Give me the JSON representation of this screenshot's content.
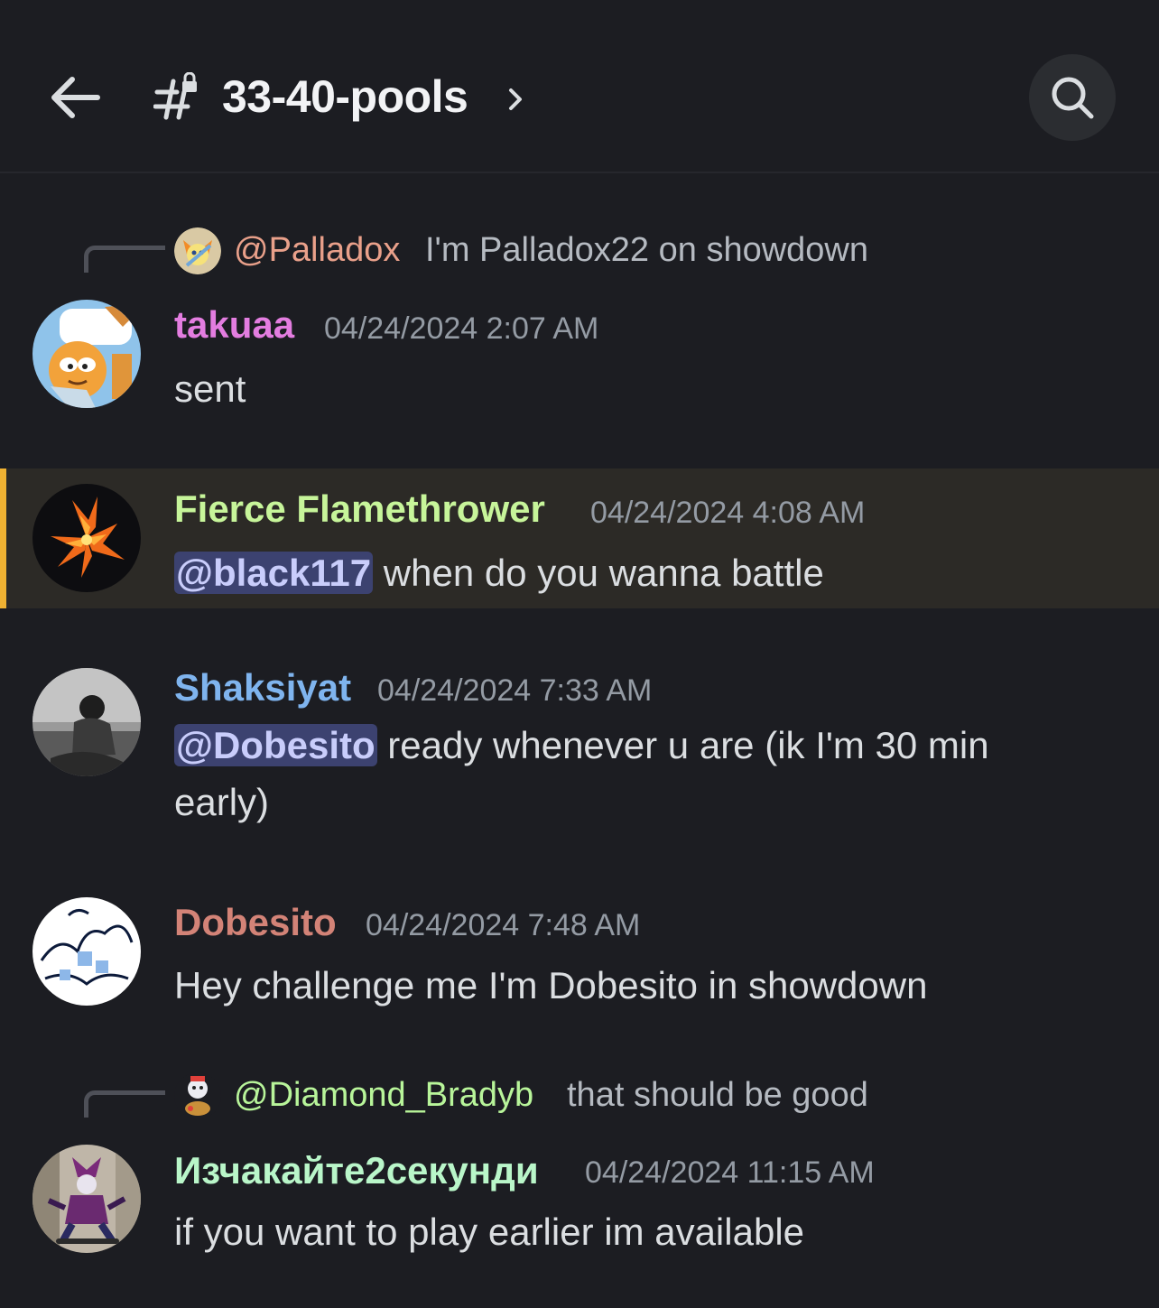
{
  "header": {
    "channel_name": "33-40-pools"
  },
  "messages": [
    {
      "reply": {
        "mention": "@Palladox",
        "text": "I'm Palladox22 on showdown",
        "name_color": "#e9a08a"
      },
      "username": "takuaa",
      "username_color": "#e37de0",
      "timestamp": "04/24/2024 2:07 AM",
      "text": "sent"
    },
    {
      "username": "Fierce Flamethrower",
      "username_color": "#c7f59a",
      "timestamp": "04/24/2024 4:08 AM",
      "mention": "@black117",
      "text": " when do you wanna battle",
      "highlighted": true
    },
    {
      "username": "Shaksiyat",
      "username_color": "#7fb4ee",
      "timestamp": "04/24/2024 7:33 AM",
      "mention": "@Dobesito",
      "text_line1": " ready whenever u are (ik I'm 30 min",
      "text_line2": "early)"
    },
    {
      "username": "Dobesito",
      "username_color": "#d38377",
      "timestamp": "04/24/2024 7:48 AM",
      "text": "Hey challenge me I'm Dobesito in showdown"
    },
    {
      "reply": {
        "mention": "@Diamond_Bradyb",
        "text": "that should be good",
        "name_color": "#b8f59a"
      },
      "username": "Изчакайте2секунди",
      "username_color": "#b9f6c9",
      "timestamp": "04/24/2024 11:15 AM",
      "text": "if you want to play earlier im available"
    }
  ],
  "icons": [
    "back-arrow-icon",
    "channel-hash-icon",
    "chevron-right-icon",
    "search-icon"
  ]
}
